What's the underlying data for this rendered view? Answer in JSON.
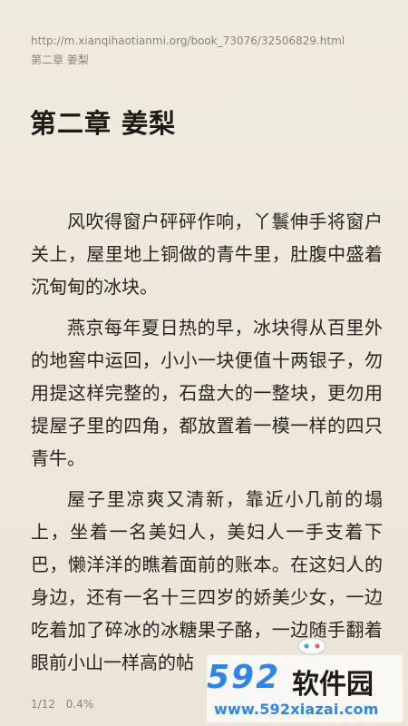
{
  "page": {
    "url": "http://m.xianqihaotianmi.org/book_73076/32506829.html",
    "breadcrumb": "第二章 姜梨"
  },
  "chapter": {
    "title": "第二章 姜梨",
    "paragraphs": [
      "风吹得窗户砰砰作响，丫鬟伸手将窗户关上，屋里地上铜做的青牛里，肚腹中盛着沉甸甸的冰块。",
      "燕京每年夏日热的早，冰块得从百里外的地窖中运回，小小一块便值十两银子，勿用提这样完整的，石盘大的一整块，更勿用提屋子里的四角，都放置着一模一样的四只青牛。",
      "屋子里凉爽又清新，靠近小几前的塌上，坐着一名美妇人，美妇人一手支着下巴，懒洋洋的瞧着面前的账本。在这妇人的身边，还有一名十三四岁的娇美少女，一边吃着加了碎冰的冰糖果子酪，一边随手翻着眼前小山一样高的帖"
    ]
  },
  "footer": {
    "page": "1/12",
    "progress": "0.4%"
  },
  "watermark": {
    "brand_num": "592",
    "brand_cn": "软件园",
    "site": "www.592xiazai.com"
  }
}
